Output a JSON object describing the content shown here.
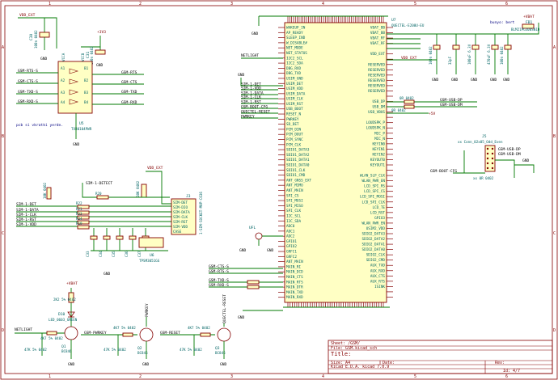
{
  "border": {
    "top_numbers": [
      "1",
      "2",
      "3",
      "4",
      "5",
      "6"
    ],
    "bottom_numbers": [
      "1",
      "2",
      "3",
      "4",
      "5",
      "6"
    ],
    "left_letters": [
      "A",
      "B",
      "C",
      "D"
    ],
    "right_letters": [
      "A",
      "B",
      "C",
      "D"
    ]
  },
  "title_block": {
    "sheet": "Sheet: /GSM/",
    "file": "File: GSM.kicad_sch",
    "title_label": "Title:",
    "size": "Size: A4",
    "date": "Date:",
    "kicad": "KiCad E.D.A.  kicad 7.0.9",
    "rev": "Rev:",
    "id": "Id: 4/7"
  },
  "u7": {
    "ref": "U7",
    "value": "QUECTEL-E200U-EU",
    "left_pins": [
      "WAKEUP_IN",
      "AP_READY",
      "SLEEP_IND",
      "W_DISABLE#",
      "NET_MODE",
      "NET_STATUS",
      "I2C2_SCL",
      "I2C2_SDA",
      "DBG_RXD",
      "DBG_TXD",
      "USIM_GND",
      "USIM_DET",
      "USIM_VDD",
      "USIM_DATA",
      "USIM_CLK",
      "USIM_RST",
      "USB_BOOT",
      "RESET_N",
      "PWRKEY",
      "SD_DET",
      "PCM_DIN",
      "PCM_DOUT",
      "PCM_SYNC",
      "PCM_CLK",
      "SDIO1_DATA3",
      "SDIO1_DATA2",
      "SDIO1_DATA1",
      "SDIO1_DATA0",
      "SDIO1_CLK",
      "SDIO1_CMD",
      "ANT_GNSS_EXT",
      "ANT_MIMO",
      "ANT_MAIN",
      "SPI_CS",
      "SPI_MOSI",
      "SPI_MISO",
      "SPI_CLK",
      "I2C_SCL",
      "I2C_SDA",
      "ADC0",
      "ADC1",
      "ADC2",
      "GPIO1",
      "GPIO2",
      "GRFC1",
      "GRFC2",
      "ANT_MAIN",
      "MAIN_RI",
      "MAIN_DCD",
      "MAIN_CTS",
      "MAIN_RTS",
      "MAIN_DTR",
      "MAIN_TXD",
      "MAIN_RXD"
    ],
    "right_pins": [
      "VBAT_BB",
      "VBAT_BB",
      "VBAT_RF",
      "VBAT_RF",
      "",
      "VDD_EXT",
      "",
      "RESERVED",
      "RESERVED",
      "RESERVED",
      "RESERVED",
      "RESERVED",
      "RESERVED",
      "",
      "USB_DP",
      "USB_DM",
      "USB_VBUS",
      "",
      "LOUDSPK_P",
      "LOUDSPK_N",
      "MIC_P",
      "MIC_N",
      "KEYIN0",
      "KEYIN1",
      "KEYIN2",
      "KEYOUT0",
      "KEYOUT1",
      "",
      "WLAN_SLP_CLK",
      "WLAN_PWR_EN",
      "LCD_SPI_RS",
      "LCD_SPI_CS",
      "LCD_SPI_MOSI",
      "LCD_SPI_CLK",
      "LCD_TE",
      "LCD_RST",
      "GPIO3",
      "WLAN_PWR_EN",
      "USIM2_VDD",
      "SDIO2_DATA3",
      "SDIO2_DATA2",
      "SDIO2_DATA1",
      "SDIO2_DATA0",
      "SDIO2_CLK",
      "SDIO2_CMD",
      "AUX_TXD",
      "AUX_RXD",
      "AUX_CTS",
      "AUX_RTS",
      "ISINK",
      "",
      ""
    ],
    "top_pin_count": 52,
    "bottom_pin_count": 44
  },
  "nets": {
    "vdd_ext": "VDD_EXT",
    "plus_3v3": "+3V3",
    "plus_vbat": "+VBAT",
    "plus_5v": "+5V",
    "netlight": "NETLIGHT",
    "gnd": "GND",
    "left_u7": [
      "SIM-1-DET",
      "SIM-1-VDD",
      "SIM-1-DATA",
      "SIM-1-CLK",
      "SIM-1-RST",
      "GSM-BOOT-CFG",
      "QUECTEL-RESET",
      "PWRKEY"
    ],
    "bottom_u7": [
      "GSM-CTS-S",
      "GSM-RTS-S",
      "GSM-TXD-S",
      "GSM-RXD-S"
    ],
    "usb": [
      "GSM-USB-DP",
      "GSM-USB-DM"
    ],
    "u5_left": [
      "GSM-RTS-S",
      "GSM-CTS-S",
      "GSM-TXD-S",
      "GSM-RXD-S"
    ],
    "u5_right": [
      "GSM-RTS",
      "GSM-CTS",
      "GSM-TXD",
      "GSM-RXD"
    ],
    "sim_left": [
      "SIM-1-DET",
      "SIM-1-DATA",
      "SIM-1-CLK",
      "SIM-1-RST",
      "SIM-1-VDD"
    ],
    "sim_detect": "SIM-1-DETECT",
    "j3_pins": [
      "SIM-DET",
      "SIM-DIO",
      "SIM-DATA",
      "SIM-CLK",
      "SIM-RST",
      "SIM-VDD",
      "CASE"
    ],
    "j5": [
      "GSM-USB-DP",
      "GSM-USB-DM"
    ],
    "j5_boot": "GSM-BOOT-CFG",
    "pwrkey_net": "GSM-PWRKEY",
    "reset_net": "GSM-RESET",
    "pwrkey_top": "PWRKEY",
    "reset_top": "QUECTEL-RESET"
  },
  "refs": {
    "u5": {
      "ref": "U5",
      "value": "TXB0104PWR",
      "pins_left": [
        "A1",
        "A2",
        "A3",
        "A4"
      ],
      "pins_right": [
        "B1",
        "B2",
        "B3",
        "B4"
      ],
      "top": [
        "VCCA",
        "VCCB"
      ]
    },
    "u6": {
      "ref": "U6",
      "value": "TPSM3051GG"
    },
    "j3": {
      "ref": "J3",
      "value": "1-SIM-SOCKET-MUP-C636"
    },
    "j5": {
      "ref": "J5",
      "value": "xx Conn_02x05_Odd_Even"
    },
    "ufl": {
      "ref": "UFL",
      "value": "ANT"
    },
    "fb1": {
      "ref": "FB1",
      "value": "BLM21PG300SN1D"
    },
    "d10": {
      "ref": "D10",
      "value": "LED_0603_GREEN"
    },
    "q1": {
      "ref": "Q1",
      "value": "BC846"
    },
    "q2": {
      "ref": "Q2",
      "value": "BC846"
    },
    "q3": {
      "ref": "Q3",
      "value": "BC846"
    }
  },
  "components": {
    "c_top_left": [
      "C30",
      "100n 0402"
    ],
    "c_top_mid": [
      "C31",
      "100n 0402"
    ],
    "resistors_sim": [
      "R20",
      "R22",
      "R21",
      "R23",
      "R24",
      "R19"
    ],
    "r_values": [
      "0R 0402",
      "10K 0402",
      "55R 0402"
    ],
    "caps_bottom": [
      "C33",
      "C34",
      "C35",
      "C36",
      "C37"
    ],
    "cap_values": [
      "100n 0402",
      "33p 0402"
    ],
    "vbat_caps": [
      "100uF 0402",
      "33pF 0402",
      "10uF 0402",
      "C40",
      "C41"
    ],
    "vbat_cap_vals": [
      "100n 0402",
      "33pF",
      "100uF 6.3V",
      "470uF 6.3V"
    ],
    "led_res": [
      "2K2 5% 0402",
      "4K7 5% 0402",
      "47K 5% 0402"
    ],
    "usb_res": [
      "0R 0402",
      "0R 0402"
    ],
    "boot_res": "xx 0R 0402"
  },
  "notes": {
    "pcb_note": "pcb si vkratki yerde.",
    "bypass": "bunyo: bert"
  }
}
